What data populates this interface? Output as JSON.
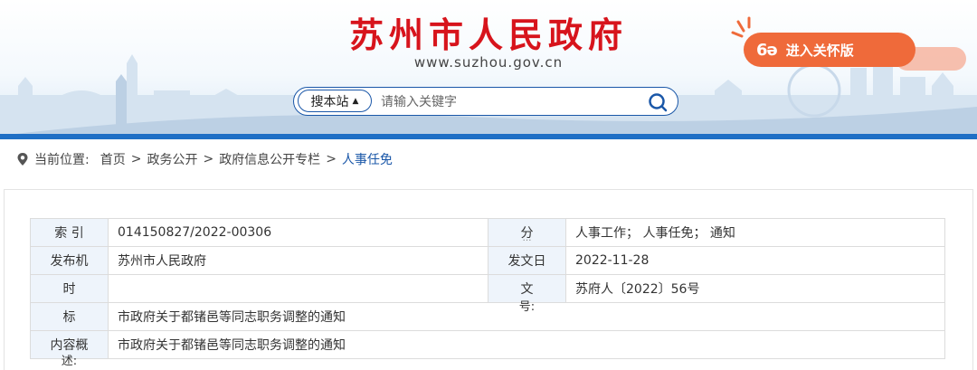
{
  "header": {
    "site_title": "苏州市人民政府",
    "site_url": "www.suzhou.gov.cn",
    "care_mode_label": "进入关怀版",
    "care_icon": "glasses-icon",
    "search": {
      "scope_label": "搜本站",
      "placeholder": "请输入关键字",
      "button_icon": "search-icon"
    }
  },
  "breadcrumb": {
    "label": "当前位置:",
    "items": [
      "首页",
      "政务公开",
      "政府信息公开专栏",
      "人事任免"
    ],
    "separator": ">"
  },
  "info": {
    "index_label": "索 引",
    "index_value": "014150827/2022-00306",
    "category_label": "分",
    "category_value": "人事工作； 人事任免； 通知",
    "publisher_label": "发布机",
    "publisher_value": "苏州市人民政府",
    "date_label": "发文日",
    "date_value": "2022-11-28",
    "time_label": "时",
    "doc_label": "文",
    "doc_value": "苏府人〔2022〕56号",
    "doc_label_tail": "号:",
    "title_label": "标",
    "title_value": "市政府关于都锗邑等同志职务调整的通知",
    "summary_label": "内容概",
    "summary_value": "市政府关于都锗邑等同志职务调整的通知",
    "summary_label_tail": "述:"
  },
  "colors": {
    "title_red": "#d7141c",
    "accent_blue": "#1a57a8",
    "care_orange": "#ef6a3a",
    "label_bg": "#eef4fb"
  }
}
